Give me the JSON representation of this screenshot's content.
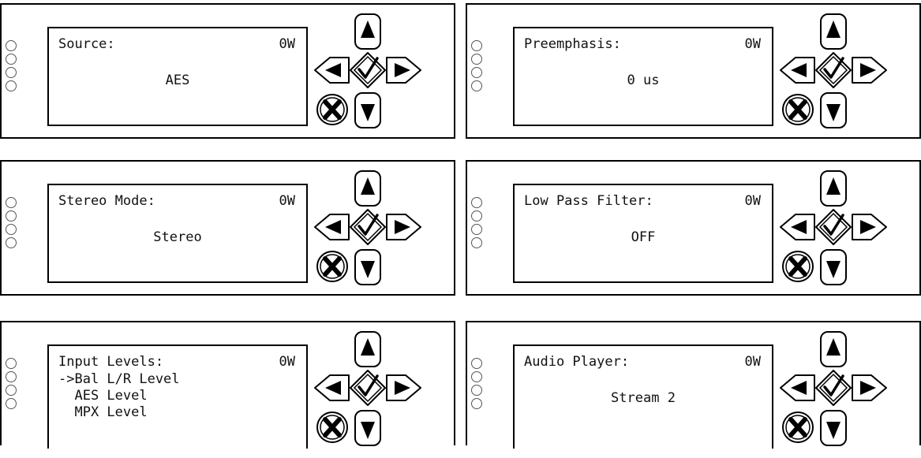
{
  "panels": [
    {
      "title": "Source:",
      "power": "0W",
      "value": "AES"
    },
    {
      "title": "Preemphasis:",
      "power": "0W",
      "value": "0 us"
    },
    {
      "title": "Stereo Mode:",
      "power": "0W",
      "value": "Stereo"
    },
    {
      "title": "Low Pass Filter:",
      "power": "0W",
      "value": "OFF"
    },
    {
      "title": "Input Levels:",
      "power": "0W",
      "list": [
        "->Bal L/R Level",
        "  AES Level",
        "  MPX Level"
      ]
    },
    {
      "title": "Audio Player:",
      "power": "0W",
      "value": "Stream 2"
    }
  ],
  "icons": {
    "up": "up-arrow-icon",
    "down": "down-arrow-icon",
    "left": "left-arrow-icon",
    "right": "right-arrow-icon",
    "check": "checkmark-icon",
    "cancel": "cancel-x-icon",
    "led": "status-led-icon"
  }
}
